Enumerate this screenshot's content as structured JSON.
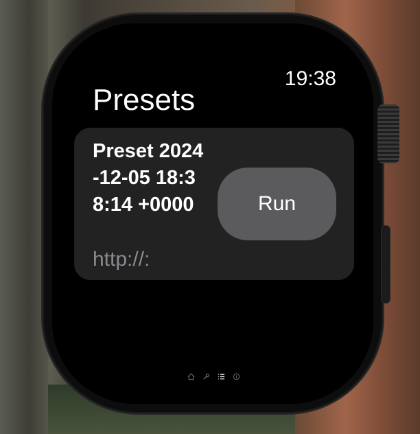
{
  "status_bar": {
    "time": "19:38"
  },
  "page": {
    "title": "Presets"
  },
  "presets": [
    {
      "name": "Preset 2024-12-05 18:38:14 +0000",
      "url": "http://:",
      "run_label": "Run"
    }
  ],
  "page_indicator": {
    "pages": [
      "home-icon",
      "wrench-icon",
      "list-icon",
      "info-icon"
    ],
    "active_index": 2
  },
  "colors": {
    "screen_bg": "#000000",
    "card_bg": "#222222",
    "button_bg": "#5b5b5e",
    "secondary_text": "#8a8a90"
  }
}
